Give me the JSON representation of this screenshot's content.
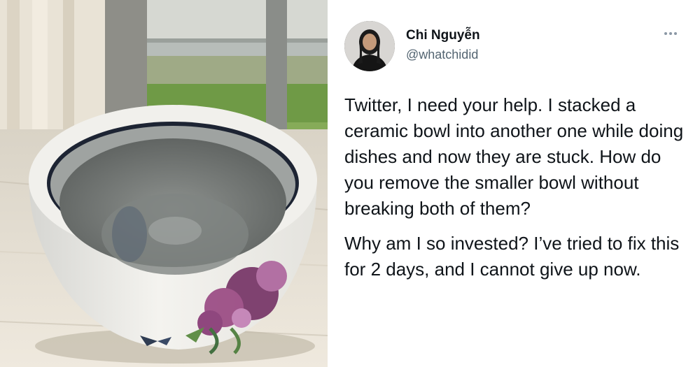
{
  "photo": {
    "description_icon": "ceramic-bowl-photo"
  },
  "tweet": {
    "author_name": "Chi Nguyễn",
    "author_handle": "@whatchidid",
    "more_icon": "ellipsis-icon",
    "paragraphs": [
      "Twitter, I need your help. I stacked a ceramic bowl into another one while doing dishes and now they are stuck. How do you remove the smaller bowl without breaking both of them?",
      "Why am I so invested? I’ve tried to fix this for 2 days, and I cannot give up now."
    ]
  }
}
